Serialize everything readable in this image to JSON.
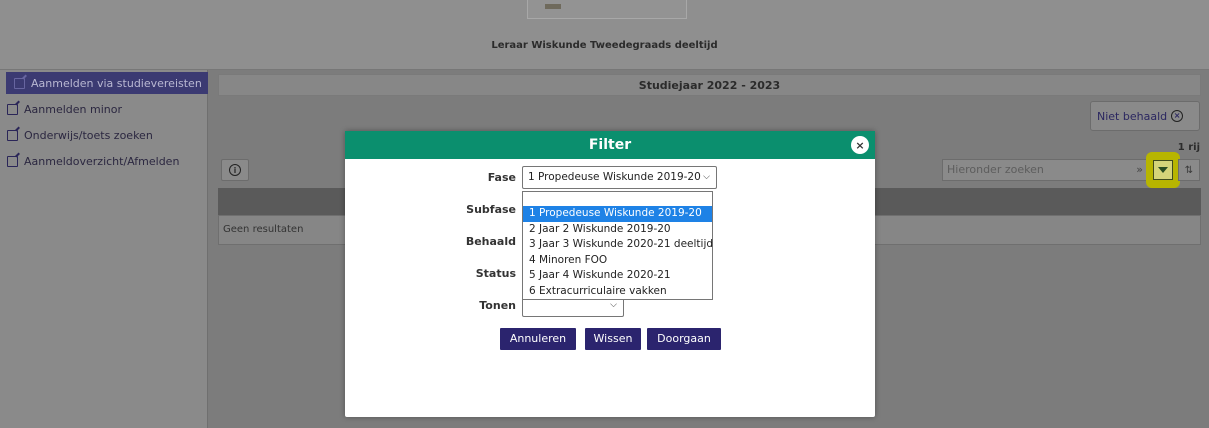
{
  "header": {
    "program_title": "Leraar Wiskunde Tweedegraads deeltijd"
  },
  "sidebar": {
    "items": [
      {
        "label": "Aanmelden via studievereisten",
        "active": true
      },
      {
        "label": "Aanmelden minor"
      },
      {
        "label": "Onderwijs/toets zoeken"
      },
      {
        "label": "Aanmeldoverzicht/Afmelden"
      }
    ]
  },
  "main": {
    "year_title": "Studiejaar 2022 - 2023",
    "filter_chip": "Niet behaald",
    "row_count": "1 rij",
    "search_placeholder": "Hieronder zoeken",
    "search_arrow": "»",
    "sort_glyph": "⇅",
    "empty_text": "Geen resultaten"
  },
  "modal": {
    "title": "Filter",
    "close_glyph": "×",
    "fields": {
      "fase_label": "Fase",
      "fase_value": "1 Propedeuse Wiskunde 2019-20",
      "subfase_label": "Subfase",
      "behaald_label": "Behaald",
      "status_label": "Status",
      "tonen_label": "Tonen",
      "tonen_value": ""
    },
    "fase_options": [
      "1 Propedeuse Wiskunde 2019-20",
      "2 Jaar 2 Wiskunde 2019-20",
      "3 Jaar 3 Wiskunde 2020-21 deeltijd",
      "4 Minoren FOO",
      "5 Jaar 4 Wiskunde 2020-21",
      "6 Extracurriculaire vakken"
    ],
    "buttons": {
      "cancel": "Annuleren",
      "clear": "Wissen",
      "proceed": "Doorgaan"
    }
  },
  "colors": {
    "modal_header": "#0b8f6e",
    "button": "#2b246e",
    "highlight": "#e6e600",
    "selected_option": "#1e82e6"
  },
  "icons": [
    "edit-icon",
    "list-icon",
    "info-icon",
    "filter-icon",
    "sort-icon",
    "close-icon",
    "clear-chip-icon"
  ]
}
